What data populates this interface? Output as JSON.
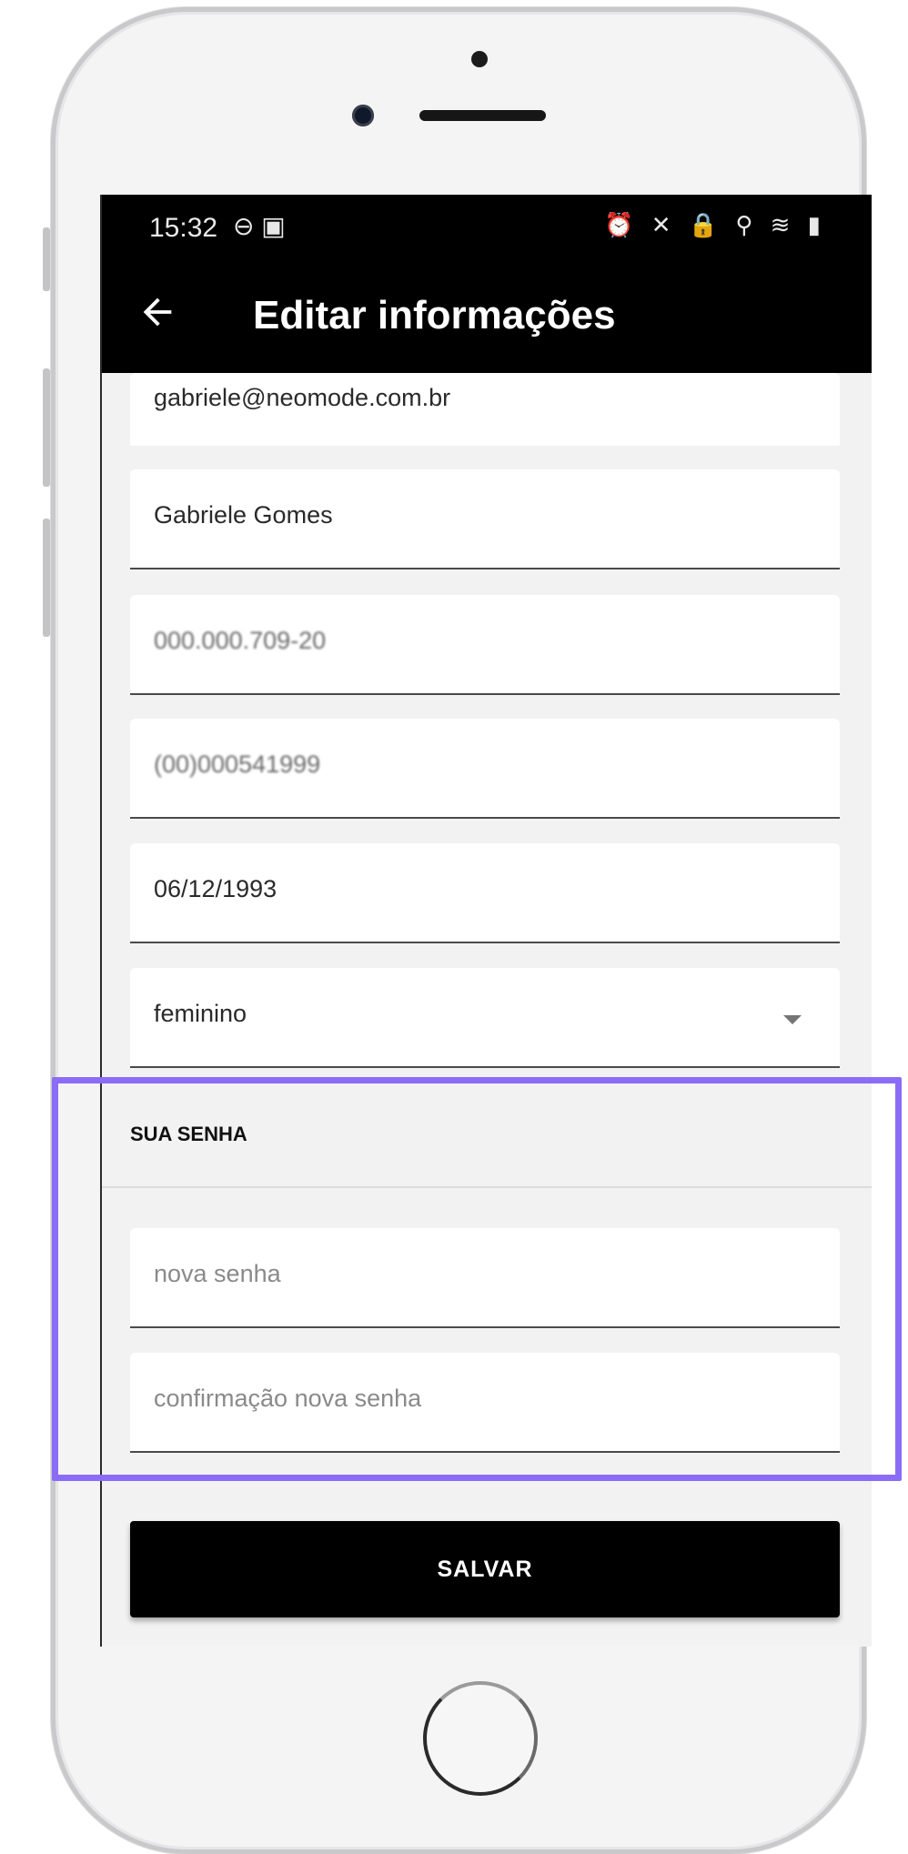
{
  "status_bar": {
    "time": "15:32",
    "left_icons": "⊖ ▣",
    "right_icons": "⏰ ✕ 🔒 ⚲ ≋ ▮"
  },
  "app_bar": {
    "back_icon": "arrow-left-icon",
    "title": "Editar informações"
  },
  "form": {
    "email": "gabriele@neomode.com.br",
    "name": "Gabriele Gomes",
    "cpf": "000.000.709-20",
    "phone": "(00)000541999",
    "birthdate": "06/12/1993",
    "gender": "feminino"
  },
  "password_section": {
    "title": "SUA SENHA",
    "new_password_placeholder": "nova senha",
    "confirm_password_placeholder": "confirmação nova senha"
  },
  "save_button": "SALVAR",
  "colors": {
    "highlight": "#8b6cf6",
    "app_bar": "#000000",
    "screen_bg": "#f2f2f2"
  }
}
